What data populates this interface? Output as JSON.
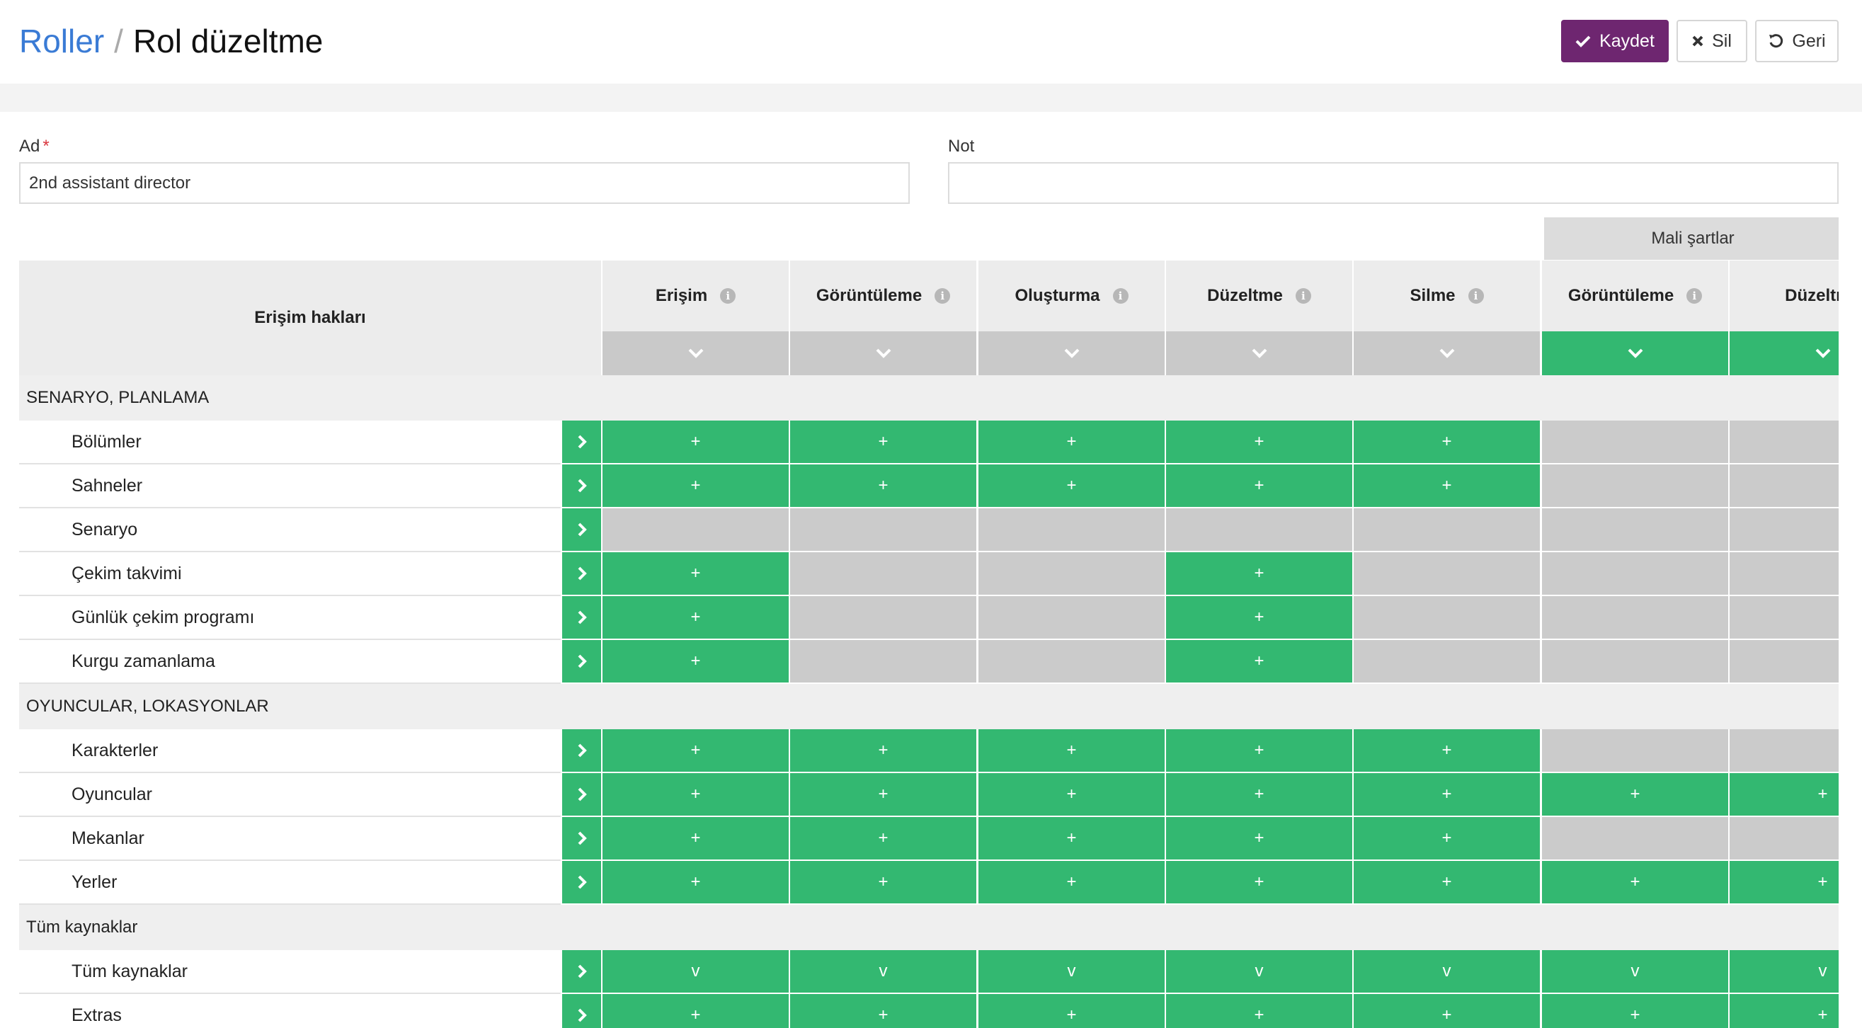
{
  "breadcrumb": {
    "parent": "Roller",
    "separator": "/",
    "current": "Rol düzeltme"
  },
  "toolbar": {
    "save_label": "Kaydet",
    "delete_label": "Sil",
    "back_label": "Geri"
  },
  "form": {
    "name_label": "Ad",
    "name_required_mark": "*",
    "name_value": "2nd assistant director",
    "note_label": "Not",
    "note_value": ""
  },
  "colors": {
    "accent": "#6e2670",
    "link": "#3a7bd5",
    "on": "#33b871",
    "off": "#c9c9c9"
  },
  "grid": {
    "corner_label": "Erişim hakları",
    "group_label": "Mali şartlar",
    "columns": [
      {
        "label": "Erişim",
        "info": true,
        "toggle_on": false
      },
      {
        "label": "Görüntüleme",
        "info": true,
        "toggle_on": false
      },
      {
        "label": "Oluşturma",
        "info": true,
        "toggle_on": false
      },
      {
        "label": "Düzeltme",
        "info": true,
        "toggle_on": false
      },
      {
        "label": "Silme",
        "info": true,
        "toggle_on": false
      },
      {
        "label": "Görüntüleme",
        "info": true,
        "toggle_on": true
      },
      {
        "label": "Düzeltme",
        "info": false,
        "toggle_on": true
      }
    ],
    "sections": [
      {
        "title": "SENARYO, PLANLAMA",
        "rows": [
          {
            "label": "Bölümler",
            "cells": [
              "+",
              "+",
              "+",
              "+",
              "+",
              "",
              ""
            ]
          },
          {
            "label": "Sahneler",
            "cells": [
              "+",
              "+",
              "+",
              "+",
              "+",
              "",
              ""
            ]
          },
          {
            "label": "Senaryo",
            "cells": [
              "",
              "",
              "",
              "",
              "",
              "",
              ""
            ]
          },
          {
            "label": "Çekim takvimi",
            "cells": [
              "+",
              "",
              "",
              "+",
              "",
              "",
              ""
            ]
          },
          {
            "label": "Günlük çekim programı",
            "cells": [
              "+",
              "",
              "",
              "+",
              "",
              "",
              ""
            ]
          },
          {
            "label": "Kurgu zamanlama",
            "cells": [
              "+",
              "",
              "",
              "+",
              "",
              "",
              ""
            ]
          }
        ]
      },
      {
        "title": "OYUNCULAR, LOKASYONLAR",
        "rows": [
          {
            "label": "Karakterler",
            "cells": [
              "+",
              "+",
              "+",
              "+",
              "+",
              "",
              ""
            ]
          },
          {
            "label": "Oyuncular",
            "cells": [
              "+",
              "+",
              "+",
              "+",
              "+",
              "+",
              "+"
            ]
          },
          {
            "label": "Mekanlar",
            "cells": [
              "+",
              "+",
              "+",
              "+",
              "+",
              "",
              ""
            ]
          },
          {
            "label": "Yerler",
            "cells": [
              "+",
              "+",
              "+",
              "+",
              "+",
              "+",
              "+"
            ]
          }
        ]
      },
      {
        "title": "Tüm kaynaklar",
        "rows": [
          {
            "label": "Tüm kaynaklar",
            "cells": [
              "v",
              "v",
              "v",
              "v",
              "v",
              "v",
              "v"
            ]
          },
          {
            "label": "Extras",
            "cells": [
              "+",
              "+",
              "+",
              "+",
              "+",
              "+",
              "+"
            ]
          }
        ]
      }
    ]
  }
}
